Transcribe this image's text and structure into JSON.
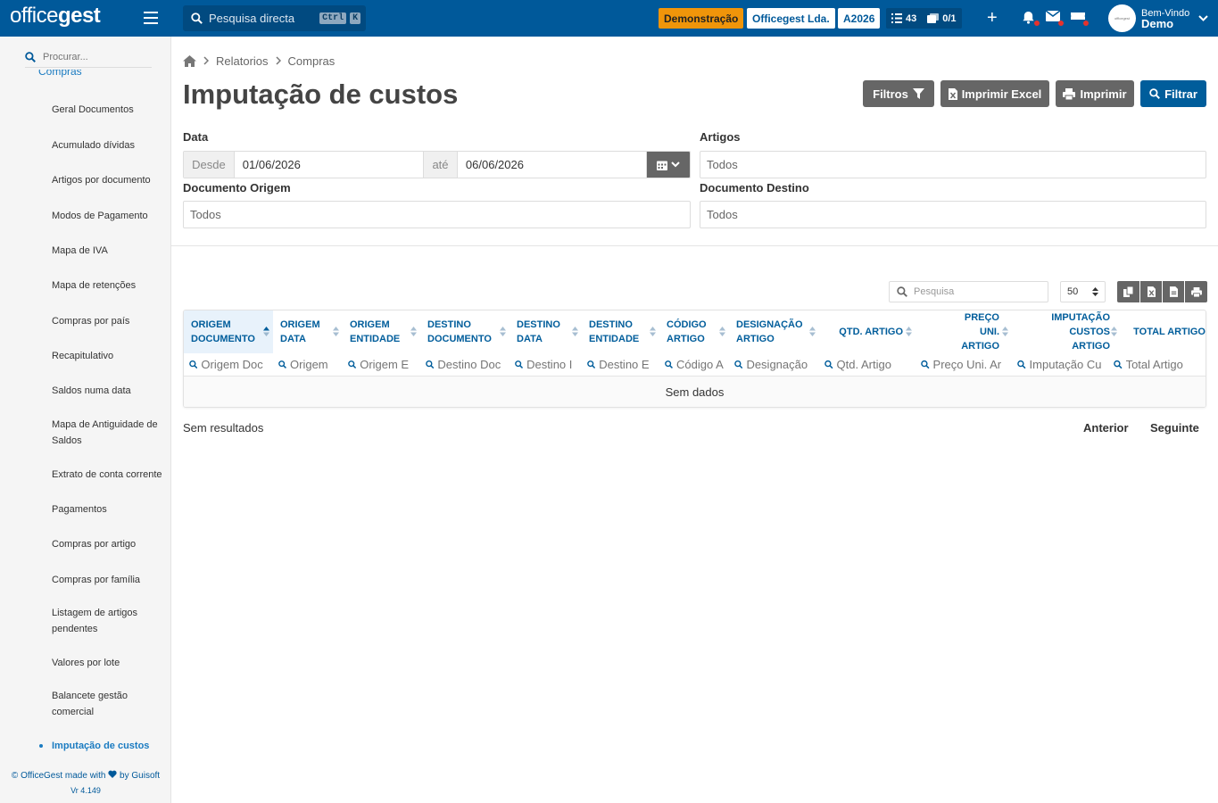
{
  "topbar": {
    "logo_text": "officegest",
    "quick_search_label": "Pesquisa directa",
    "quick_search_kbd1": "Ctrl",
    "quick_search_kbd2": "K",
    "demo_badge": "Demonstração",
    "company_badge": "Officegest Lda.",
    "year_badge": "A2026",
    "tasks_count": "43",
    "docs_count": "0/1",
    "add_label": "+",
    "welcome": "Bem-Vindo",
    "user_name": "Demo",
    "avatar_text": "officegest"
  },
  "sidebar": {
    "search_placeholder": "Procurar...",
    "section": "Compras",
    "items": [
      {
        "label": "Geral Documentos"
      },
      {
        "label": "Acumulado dívidas"
      },
      {
        "label": "Artigos por documento"
      },
      {
        "label": "Modos de Pagamento"
      },
      {
        "label": "Mapa de IVA"
      },
      {
        "label": "Mapa de retenções"
      },
      {
        "label": "Compras por país"
      },
      {
        "label": "Recapitulativo"
      },
      {
        "label": "Saldos numa data"
      },
      {
        "label": "Mapa de Antiguidade de Saldos"
      },
      {
        "label": "Extrato de conta corrente"
      },
      {
        "label": "Pagamentos"
      },
      {
        "label": "Compras por artigo"
      },
      {
        "label": "Compras por família"
      },
      {
        "label": "Listagem de artigos pendentes"
      },
      {
        "label": "Valores por lote"
      },
      {
        "label": "Balancete gestão comercial"
      },
      {
        "label": "Imputação de custos"
      }
    ],
    "footer_line1": "© OfficeGest made with",
    "footer_by": "by Guisoft",
    "footer_version": "Vr 4.149"
  },
  "breadcrumb": {
    "items": [
      "Relatorios",
      "Compras"
    ]
  },
  "page": {
    "title": "Imputação de custos",
    "buttons": {
      "filters": "Filtros",
      "excel": "Imprimir Excel",
      "print": "Imprimir",
      "filter": "Filtrar"
    }
  },
  "form": {
    "date_label": "Data",
    "date_from_label": "Desde",
    "date_from_value": "01/06/2026",
    "date_to_label": "até",
    "date_to_value": "06/06/2026",
    "articles_label": "Artigos",
    "articles_value": "Todos",
    "origin_doc_label": "Documento Origem",
    "origin_doc_value": "Todos",
    "dest_doc_label": "Documento Destino",
    "dest_doc_value": "Todos"
  },
  "table": {
    "search_placeholder": "Pesquisa",
    "page_size": "50",
    "columns": [
      {
        "label": "ORIGEM DOCUMENTO",
        "filter": "Origem Doc"
      },
      {
        "label": "ORIGEM DATA",
        "filter": "Origem"
      },
      {
        "label": "ORIGEM ENTIDADE",
        "filter": "Origem E"
      },
      {
        "label": "DESTINO DOCUMENTO",
        "filter": "Destino Doc"
      },
      {
        "label": "DESTINO DATA",
        "filter": "Destino I"
      },
      {
        "label": "DESTINO ENTIDADE",
        "filter": "Destino E"
      },
      {
        "label": "CÓDIGO ARTIGO",
        "filter": "Código A"
      },
      {
        "label": "DESIGNAÇÃO ARTIGO",
        "filter": "Designação"
      },
      {
        "label": "QTD. ARTIGO",
        "filter": "Qtd. Artigo"
      },
      {
        "label": "PREÇO UNI. ARTIGO",
        "filter": "Preço Uni. Ar"
      },
      {
        "label": "IMPUTAÇÃO CUSTOS ARTIGO",
        "filter": "Imputação Cu"
      },
      {
        "label": "TOTAL ARTIGO",
        "filter": "Total Artigo"
      }
    ],
    "empty_text": "Sem dados",
    "results_text": "Sem resultados",
    "prev_label": "Anterior",
    "next_label": "Seguinte"
  },
  "colors": {
    "brand": "#00599a",
    "accent_orange": "#f0950a",
    "link_blue": "#1a7bc1"
  }
}
